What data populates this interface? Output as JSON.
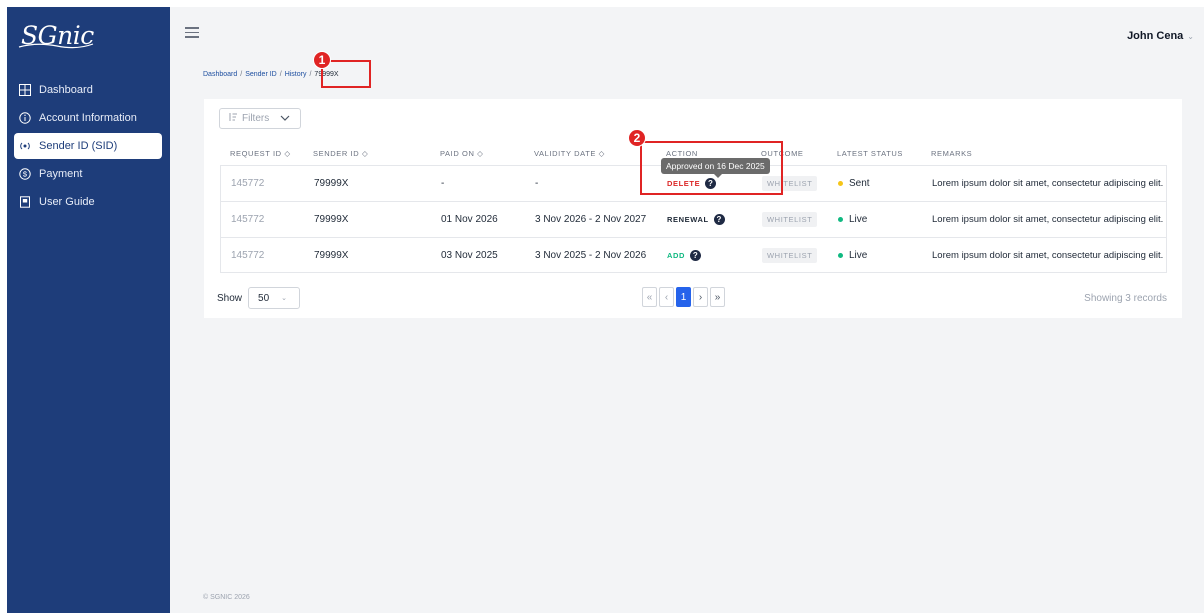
{
  "app": {
    "logo_text": "SGnic",
    "user_name": "John Cena"
  },
  "sidebar": {
    "items": [
      {
        "label": "Dashboard",
        "icon": "grid-icon",
        "active": false
      },
      {
        "label": "Account Information",
        "icon": "info-circle-icon",
        "active": false
      },
      {
        "label": "Sender ID (SID)",
        "icon": "broadcast-icon",
        "active": true
      },
      {
        "label": "Payment",
        "icon": "dollar-circle-icon",
        "active": false
      },
      {
        "label": "User Guide",
        "icon": "book-icon",
        "active": false
      }
    ]
  },
  "breadcrumb": [
    "Dashboard",
    "Sender ID",
    "History",
    "79999X"
  ],
  "filters_label": "Filters",
  "table": {
    "headers": [
      "REQUEST ID",
      "SENDER ID",
      "PAID ON",
      "VALIDITY DATE",
      "ACTION",
      "OUTCOME",
      "LATEST STATUS",
      "REMARKS"
    ],
    "rows": [
      {
        "request_id": "145772",
        "sender_id": "79999X",
        "paid_on": "-",
        "validity": "-",
        "action": "DELETE",
        "outcome": "WHITELIST",
        "status": "Sent",
        "remarks": "Lorem ipsum dolor sit amet, consectetur adipiscing elit."
      },
      {
        "request_id": "145772",
        "sender_id": "79999X",
        "paid_on": "01 Nov 2026",
        "validity": "3 Nov 2026 - 2 Nov 2027",
        "action": "RENEWAL",
        "outcome": "WHITELIST",
        "status": "Live",
        "remarks": "Lorem ipsum dolor sit amet, consectetur adipiscing elit."
      },
      {
        "request_id": "145772",
        "sender_id": "79999X",
        "paid_on": "03 Nov 2025",
        "validity": "3 Nov 2025 - 2 Nov 2026",
        "action": "ADD",
        "outcome": "WHITELIST",
        "status": "Live",
        "remarks": "Lorem ipsum dolor sit amet, consectetur adipiscing elit."
      }
    ]
  },
  "tooltip": "Approved on 16 Dec 2025",
  "pagination": {
    "show_label": "Show",
    "page_size": "50",
    "current_page": "1",
    "records_text": "Showing 3 records"
  },
  "annotations": {
    "badge1": "1",
    "badge2": "2"
  },
  "footer": {
    "copyright": "© SGNIC 2026"
  },
  "colors": {
    "sidebar_bg": "#1e3d7a",
    "accent": "#2563eb",
    "delete": "#dc2626",
    "renewal": "#1f2937",
    "add": "#10b981",
    "status_sent": "#f5c518",
    "status_live": "#10b981",
    "annotation": "#e02424"
  }
}
